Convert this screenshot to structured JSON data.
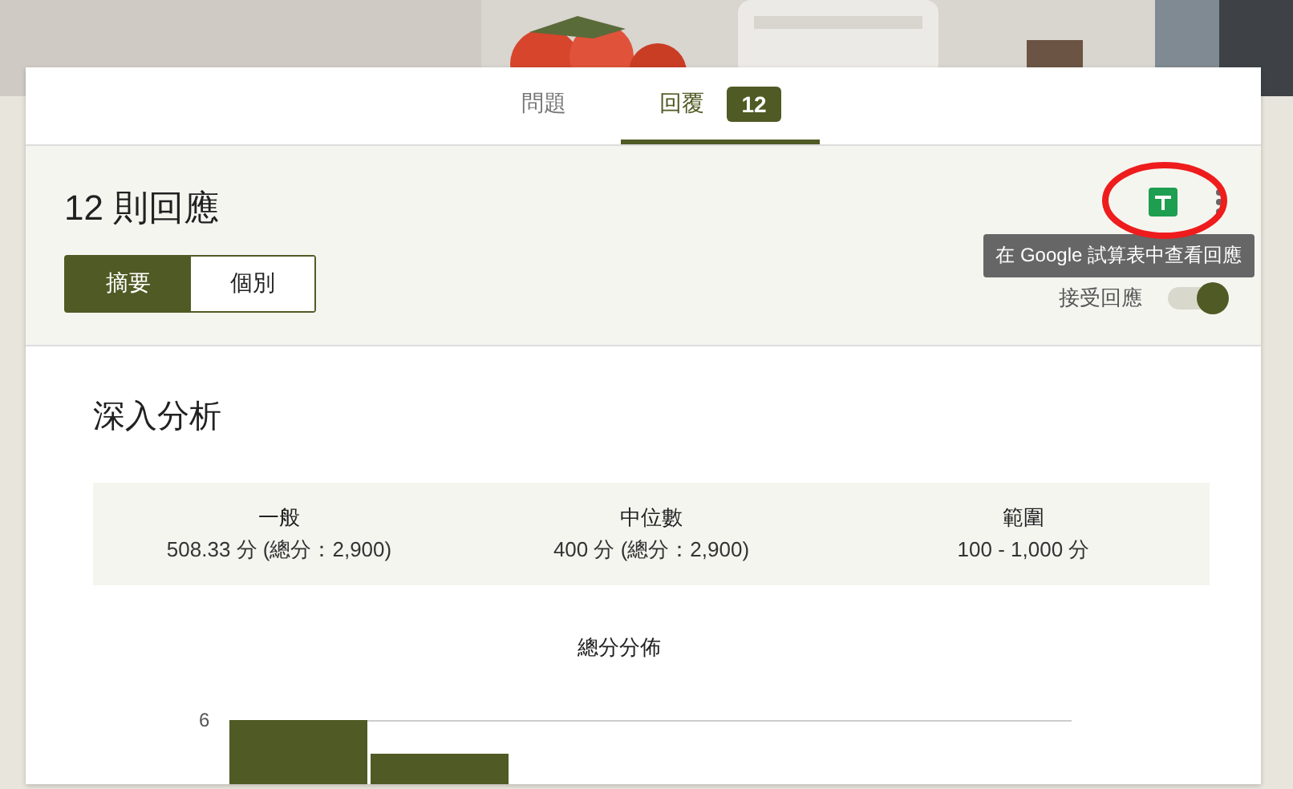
{
  "tabs": [
    {
      "label": "問題",
      "selected": false
    },
    {
      "label": "回覆",
      "selected": true,
      "badge": "12"
    }
  ],
  "header": {
    "title": "12 則回應",
    "views": [
      {
        "label": "摘要",
        "selected": true
      },
      {
        "label": "個別",
        "selected": false
      }
    ],
    "tooltip": "在 Google 試算表中查看回應",
    "accepting": {
      "label": "接受回應",
      "on": true
    }
  },
  "insights": {
    "title": "深入分析",
    "stats": [
      {
        "label": "一般",
        "value": "508.33 分 (總分：2,900)"
      },
      {
        "label": "中位數",
        "value": "400 分 (總分：2,900)"
      },
      {
        "label": "範圍",
        "value": "100 - 1,000 分"
      }
    ]
  },
  "chart": {
    "title": "總分分佈",
    "tick_label": "6"
  }
}
